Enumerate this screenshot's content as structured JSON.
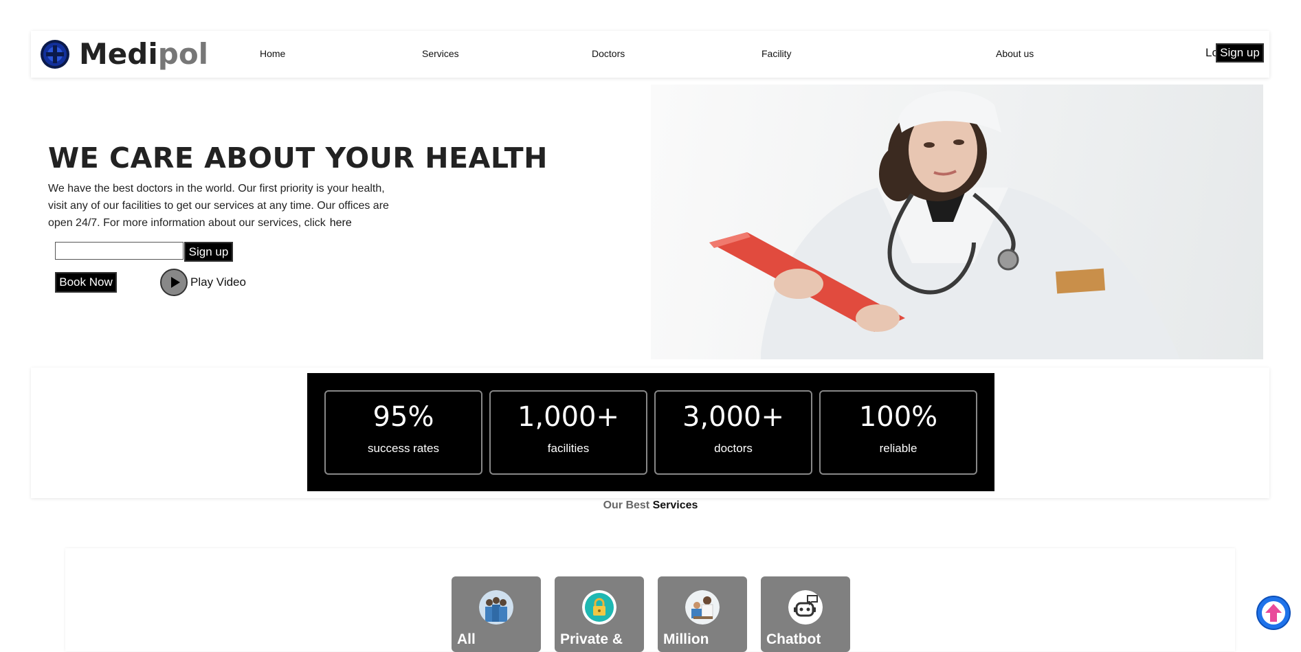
{
  "nav": {
    "brand_part1": "Medi",
    "brand_part2": "pol",
    "links": [
      "Home",
      "Services",
      "Doctors",
      "Facility",
      "About us"
    ],
    "login": "Log in",
    "signup": "Sign up"
  },
  "hero": {
    "title": "WE CARE ABOUT YOUR HEALTH",
    "text": "We have the best doctors in the world. Our first priority is your health, visit any of our facilities to get our services at any time. Our offices are open 24/7. For more information about our services, click",
    "link": "here",
    "email_value": "",
    "signup": "Sign up",
    "book": "Book Now",
    "play": "Play Video"
  },
  "stats": [
    {
      "value": "95%",
      "label": "success rates"
    },
    {
      "value": "1,000+",
      "label": "facilities"
    },
    {
      "value": "3,000+",
      "label": "doctors"
    },
    {
      "value": "100%",
      "label": "reliable"
    }
  ],
  "services": {
    "heading_part1": "Our Best",
    "heading_part2": "Services",
    "cards": [
      {
        "label": "All",
        "icon": "doctors-group-icon"
      },
      {
        "label": "Private &",
        "icon": "lock-icon"
      },
      {
        "label": "Million",
        "icon": "doctor-consult-icon"
      },
      {
        "label": "Chatbot",
        "icon": "chatbot-icon"
      }
    ]
  },
  "colors": {
    "accent": "#000000",
    "card_grey": "#808080",
    "scroll_button": "#1f73ea",
    "scroll_arrow": "#e94b9a"
  }
}
